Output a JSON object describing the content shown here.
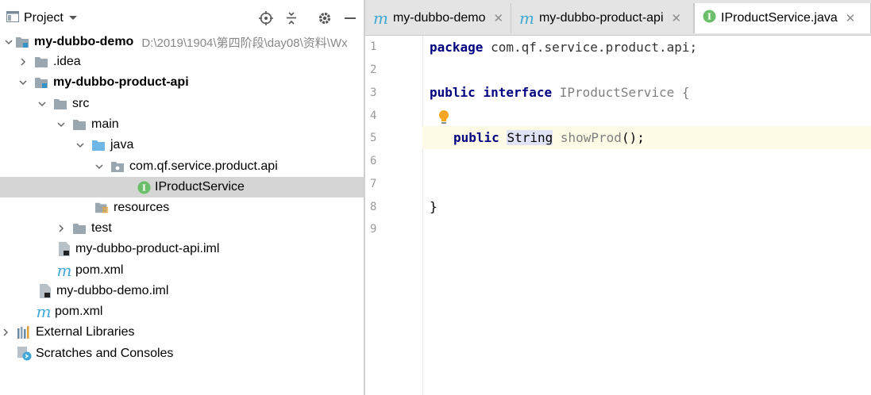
{
  "project_panel": {
    "title": "Project",
    "tree": [
      {
        "label": "my-dubbo-demo",
        "path": "D:\\2019\\1904\\第四阶段\\day08\\资料\\Wx"
      },
      {
        "label": ".idea"
      },
      {
        "label": "my-dubbo-product-api"
      },
      {
        "label": "src"
      },
      {
        "label": "main"
      },
      {
        "label": "java"
      },
      {
        "label": "com.qf.service.product.api"
      },
      {
        "label": "IProductService"
      },
      {
        "label": "resources"
      },
      {
        "label": "test"
      },
      {
        "label": "my-dubbo-product-api.iml"
      },
      {
        "label": "pom.xml"
      },
      {
        "label": "my-dubbo-demo.iml"
      },
      {
        "label": "pom.xml"
      },
      {
        "label": "External Libraries"
      },
      {
        "label": "Scratches and Consoles"
      }
    ]
  },
  "editor": {
    "tabs": [
      {
        "label": "my-dubbo-demo"
      },
      {
        "label": "my-dubbo-product-api"
      },
      {
        "label": "IProductService.java"
      }
    ],
    "line_numbers": [
      "1",
      "2",
      "3",
      "4",
      "5",
      "6",
      "7",
      "8",
      "9"
    ],
    "code": {
      "l1_kw": "package",
      "l1_rest": " com.qf.service.product.api;",
      "l3_kw1": "public",
      "l3_kw2": "interface",
      "l3_name": "IProductService",
      "l3_brace": " {",
      "l5_kw": "public",
      "l5_type": "String",
      "l5_method": "showProd",
      "l5_rest": "();",
      "l8": "}"
    }
  },
  "colors": {
    "keyword": "#000080",
    "folder": "#9aa7b0",
    "accent_m": "#3fa8d8",
    "interface_badge": "#6bbf6a"
  }
}
